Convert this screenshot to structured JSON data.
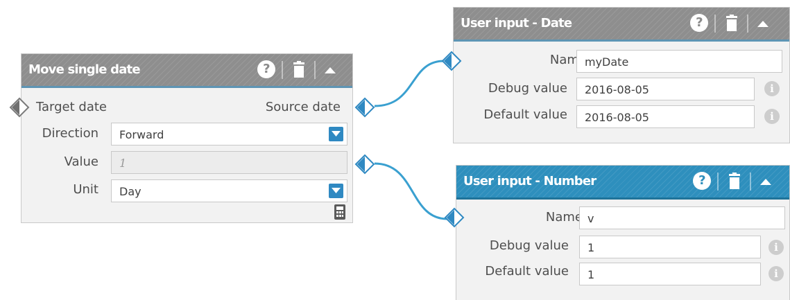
{
  "move_node": {
    "title": "Move single date",
    "target_label": "Target date",
    "source_label": "Source date",
    "direction_label": "Direction",
    "direction_value": "Forward",
    "value_label": "Value",
    "value_placeholder": "1",
    "unit_label": "Unit",
    "unit_value": "Day",
    "calculator_icon": "calculator-icon"
  },
  "date_node": {
    "title": "User input - Date",
    "name_label": "Name",
    "name_value": "myDate",
    "debug_label": "Debug value",
    "debug_value": "2016-08-05",
    "default_label": "Default value",
    "default_value": "2016-08-05"
  },
  "number_node": {
    "title": "User input - Number",
    "name_label": "Name",
    "name_value": "v",
    "debug_label": "Debug value",
    "debug_value": "1",
    "default_label": "Default value",
    "default_value": "1"
  },
  "header_tools": {
    "help": "?",
    "delete_icon": "trash-icon",
    "collapse_icon": "collapse-up-icon"
  },
  "info_glyph": "i",
  "colors": {
    "header_gray": "#8e8e8e",
    "header_blue": "#2e8fbd",
    "accent": "#2f89c2",
    "wire": "#3aa0d0"
  }
}
